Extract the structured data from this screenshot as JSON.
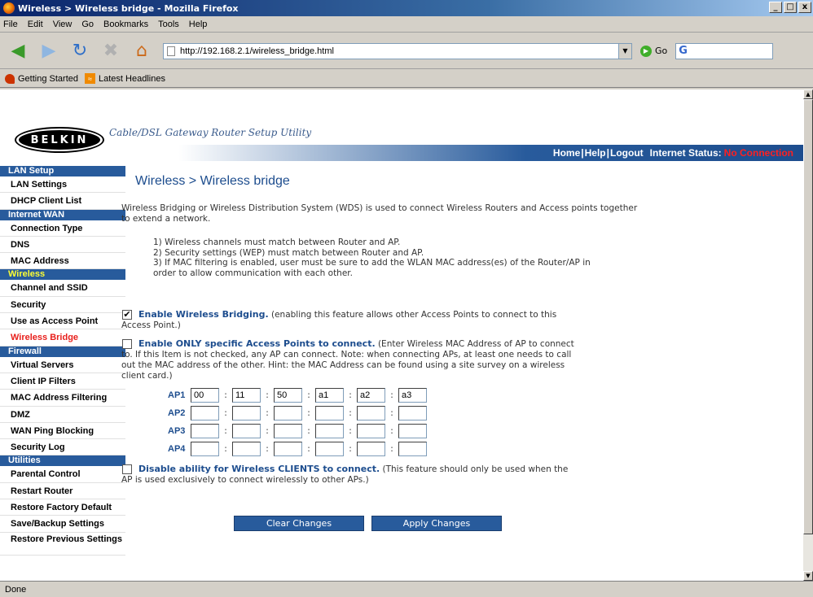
{
  "window": {
    "title": "Wireless > Wireless bridge - Mozilla Firefox"
  },
  "menu": [
    "File",
    "Edit",
    "View",
    "Go",
    "Bookmarks",
    "Tools",
    "Help"
  ],
  "toolbar": {
    "url": "http://192.168.2.1/wireless_bridge.html",
    "go_label": "Go",
    "search_glyph": "G"
  },
  "bookmarks": {
    "item1": "Getting Started",
    "item2": "Latest Headlines"
  },
  "header": {
    "logo": "BELKIN",
    "tagline": "Cable/DSL Gateway Router Setup Utility",
    "home": "Home",
    "help": "Help",
    "logout": "Logout",
    "internet_status_label": "Internet Status:",
    "internet_status_value": "No Connection"
  },
  "sidebar": {
    "sections": [
      {
        "heading": "LAN Setup",
        "items": [
          "LAN Settings",
          "DHCP Client List"
        ]
      },
      {
        "heading": "Internet WAN",
        "items": [
          "Connection Type",
          "DNS",
          "MAC Address"
        ]
      },
      {
        "heading": "Wireless",
        "items": [
          "Channel and SSID",
          "Security",
          "Use as Access Point",
          "Wireless Bridge"
        ]
      },
      {
        "heading": "Firewall",
        "items": [
          "Virtual Servers",
          "Client IP Filters",
          "MAC Address Filtering",
          "DMZ",
          "WAN Ping Blocking",
          "Security Log"
        ]
      },
      {
        "heading": "Utilities",
        "items": [
          "Parental Control",
          "Restart Router",
          "Restore Factory Default",
          "Save/Backup Settings",
          "Restore Previous Settings"
        ]
      }
    ]
  },
  "main": {
    "title": "Wireless > Wireless bridge",
    "intro": "Wireless Bridging or Wireless Distribution System (WDS) is used to connect Wireless Routers and Access points together to extend a network.",
    "note1": "1) Wireless channels must match between Router and AP.",
    "note2": "2) Security settings (WEP) must match between Router and AP.",
    "note3": "3) If MAC filtering is enabled, user must be sure to add the WLAN MAC address(es) of the Router/AP in order to allow communication with each other.",
    "opt1_bold": "Enable Wireless Bridging.",
    "opt1_text": " (enabling this feature allows other Access Points to connect to this Access Point.)",
    "opt1_checked": true,
    "opt2_bold": "Enable ONLY specific Access Points to connect.",
    "opt2_text": " (Enter Wireless MAC Address of AP to connect to. If this Item is not checked, any AP can connect. Note: when connecting APs, at least one needs to call out the MAC address of the other. Hint: the MAC Address can be found using a site survey on a wireless client card.)",
    "opt2_checked": false,
    "ap_labels": [
      "AP1",
      "AP2",
      "AP3",
      "AP4"
    ],
    "ap1": [
      "00",
      "11",
      "50",
      "a1",
      "a2",
      "a3"
    ],
    "opt3_bold": "Disable ability for Wireless CLIENTS to connect.",
    "opt3_text": " (This feature should only be used when the AP is used exclusively to connect wirelessly to other APs.)",
    "opt3_checked": false,
    "clear_btn": "Clear Changes",
    "apply_btn": "Apply Changes"
  },
  "status": {
    "text": "Done"
  }
}
